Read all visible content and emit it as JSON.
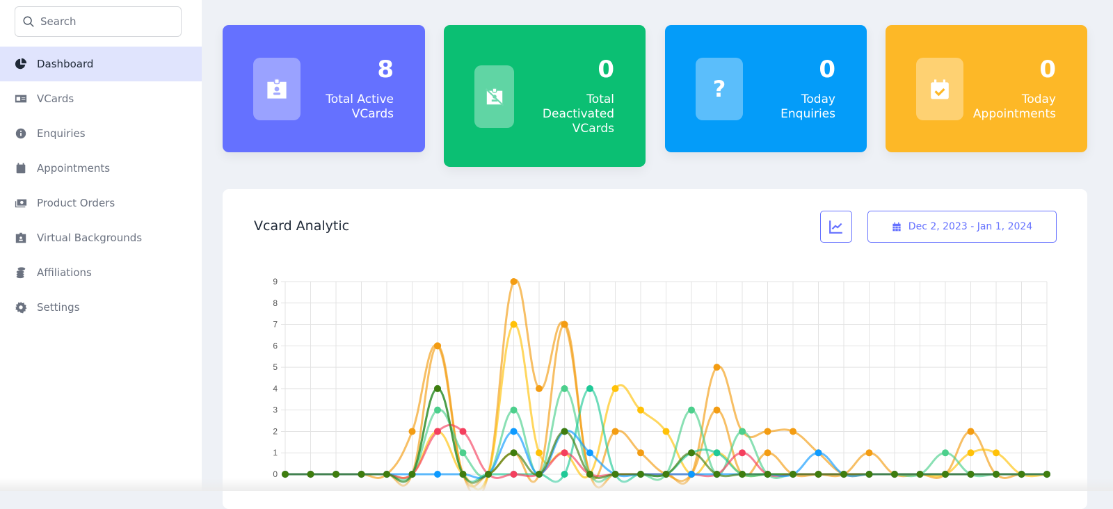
{
  "sidebar": {
    "search_placeholder": "Search",
    "items": [
      {
        "label": "Dashboard",
        "icon": "pie-chart-icon",
        "active": true
      },
      {
        "label": "VCards",
        "icon": "id-card-icon"
      },
      {
        "label": "Enquiries",
        "icon": "info-circle-icon"
      },
      {
        "label": "Appointments",
        "icon": "calendar-icon"
      },
      {
        "label": "Product Orders",
        "icon": "money-bill-icon"
      },
      {
        "label": "Virtual Backgrounds",
        "icon": "id-badge-icon"
      },
      {
        "label": "Affiliations",
        "icon": "coins-icon"
      },
      {
        "label": "Settings",
        "icon": "gear-icon"
      }
    ]
  },
  "cards": [
    {
      "value": "8",
      "label": "Total Active VCards",
      "color": "#6571ff",
      "icon": "id-badge-icon"
    },
    {
      "value": "0",
      "label": "Total Deactivated VCards",
      "color": "#0bbf73",
      "icon": "id-badge-slash-icon"
    },
    {
      "value": "0",
      "label": "Today Enquiries",
      "color": "#049cf9",
      "icon": "question-icon"
    },
    {
      "value": "0",
      "label": "Today Appointments",
      "color": "#fdb827",
      "icon": "calendar-check-icon"
    }
  ],
  "analytics": {
    "title": "Vcard Analytic",
    "date_range": "Dec 2, 2023 - Jan 1, 2024",
    "accent": "#6571ff"
  },
  "chart_data": {
    "type": "line",
    "x_range": [
      "Dec 2, 2023",
      "Jan 1, 2024"
    ],
    "ylim": [
      0,
      9
    ],
    "yticks": [
      "0",
      "1",
      "2",
      "3",
      "4",
      "5",
      "6",
      "7",
      "8",
      "9"
    ],
    "grid": true,
    "smooth": true,
    "series": [
      {
        "color": "#f39c12",
        "values": [
          0,
          0,
          0,
          0,
          0,
          2,
          6,
          0,
          0,
          9,
          4,
          7,
          0,
          0,
          0,
          0,
          0,
          5,
          2,
          2,
          2,
          1,
          0,
          0,
          0,
          0,
          0,
          0,
          0,
          0,
          0
        ]
      },
      {
        "color": "#f39c12",
        "values": [
          0,
          0,
          0,
          0,
          0,
          0,
          6,
          0,
          0,
          1,
          0,
          7,
          0,
          2,
          1,
          0,
          0,
          3,
          0,
          1,
          0,
          0,
          0,
          1,
          0,
          0,
          0,
          2,
          0,
          0,
          0
        ]
      },
      {
        "color": "#ffc107",
        "values": [
          0,
          0,
          0,
          0,
          0,
          0,
          2,
          0,
          0,
          7,
          1,
          1,
          0,
          4,
          3,
          2,
          0,
          1,
          0,
          0,
          0,
          0,
          0,
          0,
          0,
          0,
          0,
          1,
          1,
          0,
          0
        ]
      },
      {
        "color": "#4ccf8c",
        "values": [
          0,
          0,
          0,
          0,
          0,
          0,
          3,
          1,
          0,
          3,
          0,
          4,
          0,
          0,
          0,
          0,
          3,
          0,
          2,
          0,
          0,
          0,
          0,
          0,
          0,
          0,
          1,
          0,
          0,
          0,
          0
        ]
      },
      {
        "color": "#20c997",
        "values": [
          0,
          0,
          0,
          0,
          0,
          0,
          4,
          0,
          0,
          0,
          0,
          0,
          4,
          0,
          0,
          0,
          1,
          1,
          0,
          0,
          0,
          0,
          0,
          0,
          0,
          0,
          0,
          0,
          0,
          0,
          0
        ]
      },
      {
        "color": "#f43f5e",
        "values": [
          0,
          0,
          0,
          0,
          0,
          0,
          2,
          2,
          0,
          0,
          0,
          1,
          0,
          0,
          0,
          0,
          0,
          0,
          1,
          0,
          0,
          0,
          0,
          0,
          0,
          0,
          0,
          0,
          0,
          0,
          0
        ]
      },
      {
        "color": "#0d9aff",
        "values": [
          0,
          0,
          0,
          0,
          0,
          0,
          0,
          0,
          0,
          2,
          0,
          2,
          1,
          0,
          0,
          0,
          0,
          0,
          0,
          0,
          0,
          1,
          0,
          0,
          0,
          0,
          0,
          0,
          0,
          0,
          0
        ]
      },
      {
        "color": "#3f7d0e",
        "values": [
          0,
          0,
          0,
          0,
          0,
          0,
          4,
          0,
          0,
          1,
          0,
          2,
          0,
          0,
          0,
          0,
          1,
          0,
          0,
          0,
          0,
          0,
          0,
          0,
          0,
          0,
          0,
          0,
          0,
          0,
          0
        ]
      }
    ]
  }
}
